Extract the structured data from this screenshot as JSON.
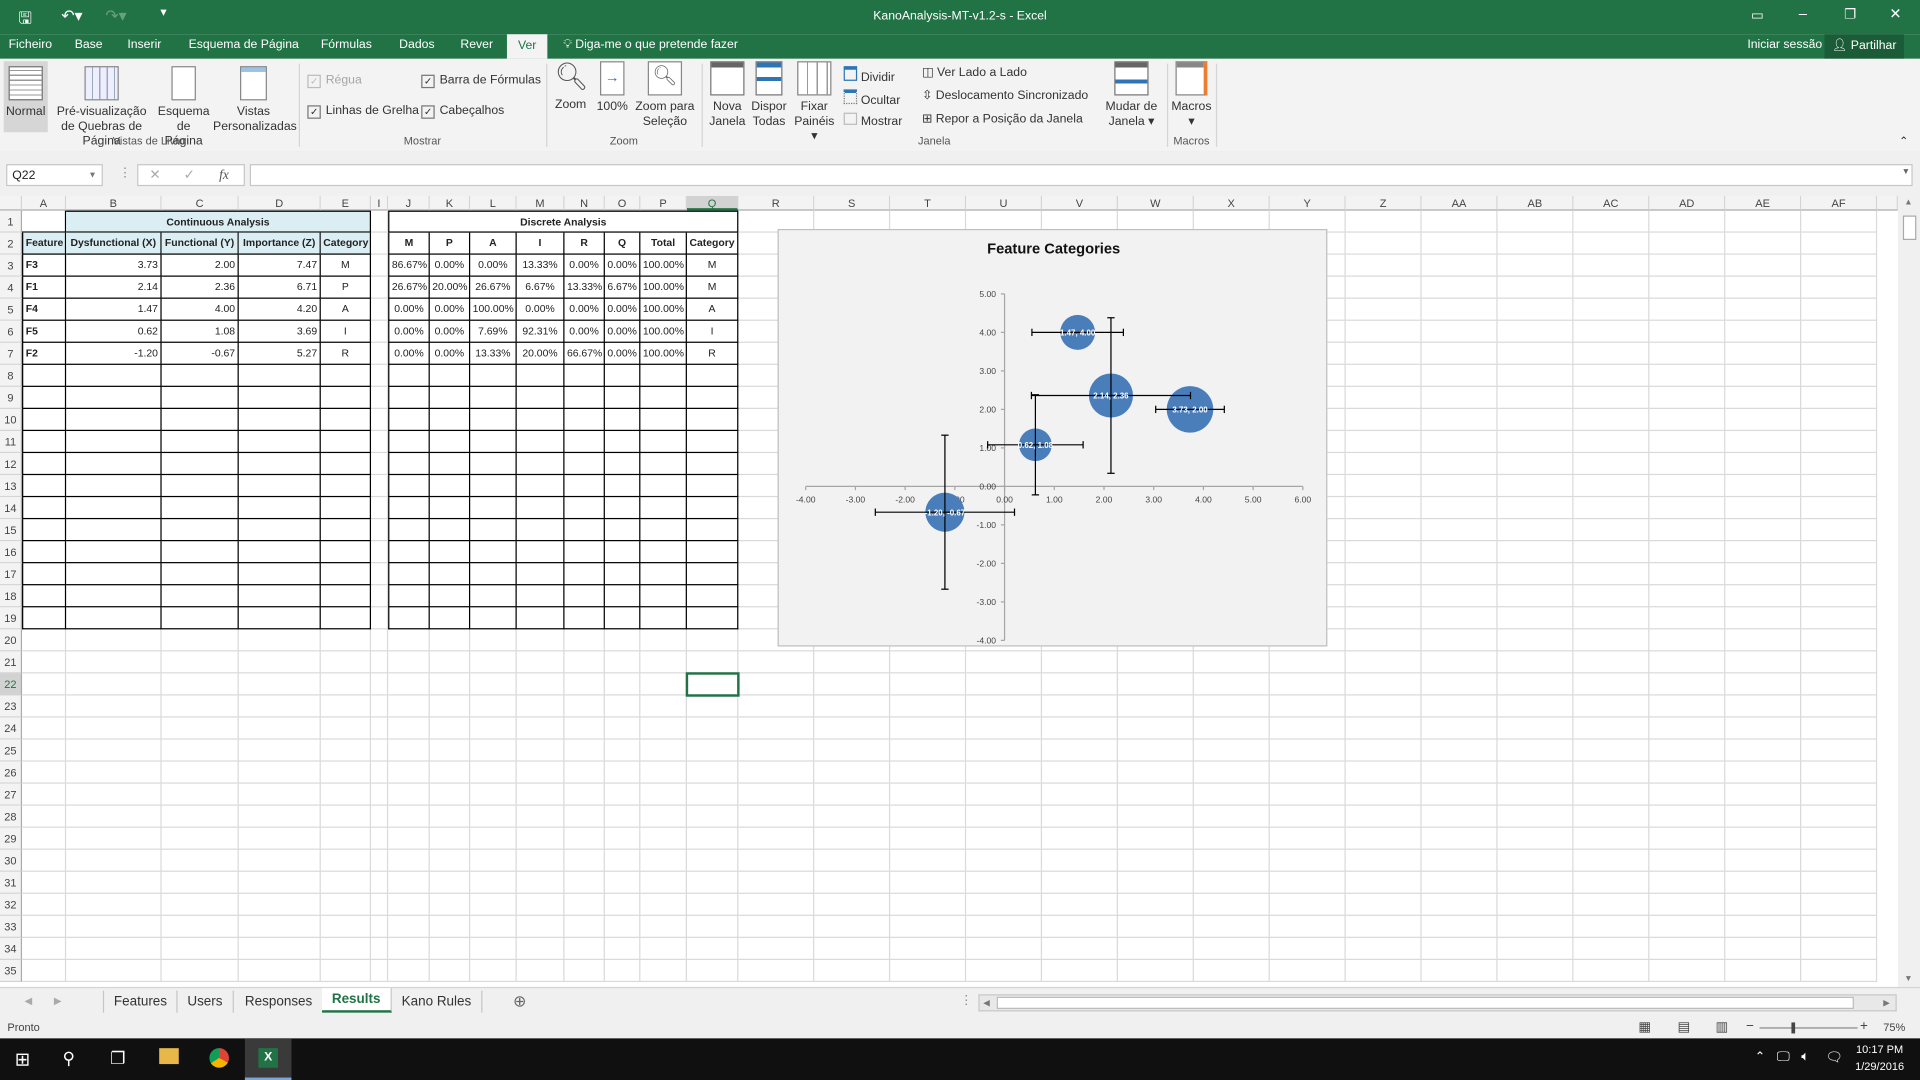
{
  "window": {
    "title": "KanoAnalysis-MT-v1.2-s - Excel",
    "sign_in": "Iniciar sessão",
    "share": "Partilhar"
  },
  "menu": {
    "tabs": [
      "Ficheiro",
      "Base",
      "Inserir",
      "Esquema de Página",
      "Fórmulas",
      "Dados",
      "Rever",
      "Ver"
    ],
    "active": "Ver",
    "tell_me": "Diga-me o que pretende fazer"
  },
  "ribbon": {
    "vistas": {
      "label": "Vistas de Livro",
      "normal": "Normal",
      "preview": "Pré-visualização de Quebras de Página",
      "layout": "Esquema de Página",
      "custom": "Vistas Personalizadas"
    },
    "mostrar": {
      "label": "Mostrar",
      "regua": "Régua",
      "barra": "Barra de Fórmulas",
      "linhas": "Linhas de Grelha",
      "cabecalhos": "Cabeçalhos"
    },
    "zoom": {
      "label": "Zoom",
      "zoom": "Zoom",
      "hundred": "100%",
      "selection": "Zoom para Seleção"
    },
    "janela": {
      "label": "Janela",
      "nova": "Nova Janela",
      "dispor": "Dispor Todas",
      "fixar": "Fixar Painéis",
      "dividir": "Dividir",
      "ocultar": "Ocultar",
      "mostrar": "Mostrar",
      "lado": "Ver Lado a Lado",
      "sinc": "Deslocamento Sincronizado",
      "repor": "Repor a Posição da Janela",
      "mudar": "Mudar de Janela"
    },
    "macros": {
      "label": "Macros",
      "macros": "Macros"
    }
  },
  "formula_bar": {
    "name_box": "Q22",
    "formula": "",
    "fx": "fx"
  },
  "sheet": {
    "continuous_title": "Continuous Analysis",
    "continuous_headers": [
      "Feature",
      "Dysfunctional (X)",
      "Functional (Y)",
      "Importance (Z)",
      "Category"
    ],
    "continuous_rows": [
      [
        "F3",
        "3.73",
        "2.00",
        "7.47",
        "M"
      ],
      [
        "F1",
        "2.14",
        "2.36",
        "6.71",
        "P"
      ],
      [
        "F4",
        "1.47",
        "4.00",
        "4.20",
        "A"
      ],
      [
        "F5",
        "0.62",
        "1.08",
        "3.69",
        "I"
      ],
      [
        "F2",
        "-1.20",
        "-0.67",
        "5.27",
        "R"
      ]
    ],
    "discrete_title": "Discrete Analysis",
    "discrete_headers": [
      "M",
      "P",
      "A",
      "I",
      "R",
      "Q",
      "Total",
      "Category"
    ],
    "discrete_rows": [
      [
        "86.67%",
        "0.00%",
        "0.00%",
        "13.33%",
        "0.00%",
        "0.00%",
        "100.00%",
        "M"
      ],
      [
        "26.67%",
        "20.00%",
        "26.67%",
        "6.67%",
        "13.33%",
        "6.67%",
        "100.00%",
        "M"
      ],
      [
        "0.00%",
        "0.00%",
        "100.00%",
        "0.00%",
        "0.00%",
        "0.00%",
        "100.00%",
        "A"
      ],
      [
        "0.00%",
        "0.00%",
        "7.69%",
        "92.31%",
        "0.00%",
        "0.00%",
        "100.00%",
        "I"
      ],
      [
        "0.00%",
        "0.00%",
        "13.33%",
        "20.00%",
        "66.67%",
        "0.00%",
        "100.00%",
        "R"
      ]
    ],
    "selected_cell": "Q22"
  },
  "chart_data": {
    "type": "bubble",
    "title": "Feature Categories",
    "xlim": [
      -4,
      6
    ],
    "ylim": [
      -4,
      5
    ],
    "x_ticks": [
      "-4.00",
      "-3.00",
      "-2.00",
      "-1.00",
      "0.00",
      "1.00",
      "2.00",
      "3.00",
      "4.00",
      "5.00",
      "6.00"
    ],
    "y_ticks": [
      "5.00",
      "4.00",
      "3.00",
      "2.00",
      "1.00",
      "0.00",
      "-1.00",
      "-2.00",
      "-3.00",
      "-4.00"
    ],
    "color": "#4a7ebb",
    "points": [
      {
        "x": 3.73,
        "y": 2.0,
        "size": 7.47,
        "label": "3.73, 2.00",
        "xerr": 0.69,
        "yerr": 0
      },
      {
        "x": 2.14,
        "y": 2.36,
        "size": 6.71,
        "label": "2.14, 2.36",
        "xerr": 1.6,
        "yerr": 2.02
      },
      {
        "x": 1.47,
        "y": 4.0,
        "size": 4.2,
        "label": "1.47, 4.00",
        "xerr": 0.92,
        "yerr": 0
      },
      {
        "x": 0.62,
        "y": 1.08,
        "size": 3.69,
        "label": "0.62, 1.08",
        "xerr": 0.96,
        "yerr": 1.3
      },
      {
        "x": -1.2,
        "y": -0.67,
        "size": 5.27,
        "label": "-1.20, -0.67",
        "xerr": 1.4,
        "yerr": 2.0
      }
    ]
  },
  "sheet_tabs": [
    "Features",
    "Users",
    "Responses",
    "Results",
    "Kano Rules"
  ],
  "active_sheet": "Results",
  "status": {
    "text": "Pronto",
    "zoom": "75%"
  },
  "taskbar": {
    "time": "10:17 PM",
    "date": "1/29/2016"
  }
}
